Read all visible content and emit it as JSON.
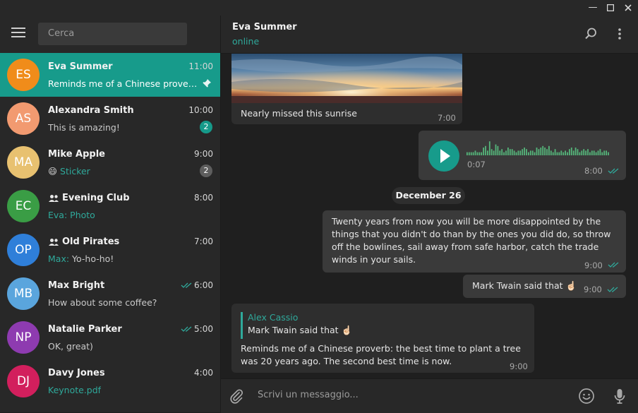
{
  "window": {
    "min_glyph": "—",
    "max_glyph": "☐",
    "close_glyph": "✕"
  },
  "sidebar": {
    "search_placeholder": "Cerca",
    "chats": [
      {
        "initials": "ES",
        "name": "Eva Summer",
        "time": "11:00",
        "preview": "Reminds me of a Chinese proverb: the best time to plant a tree…",
        "color": "#f08c1a",
        "pinned": true,
        "active": true
      },
      {
        "initials": "AS",
        "name": "Alexandra Smith",
        "time": "10:00",
        "preview": "This is amazing!",
        "color": "#f29a70",
        "badge": "2"
      },
      {
        "initials": "MA",
        "name": "Mike Apple",
        "time": "9:00",
        "preview_emoji": "😄",
        "preview": "Sticker",
        "color": "#e8c170",
        "badge": "2"
      },
      {
        "initials": "EC",
        "name": "Evening Club",
        "time": "8:00",
        "preview_sender": "Eva:",
        "preview": "Photo",
        "color": "#3a9d45",
        "group": true
      },
      {
        "initials": "OP",
        "name": "Old Pirates",
        "time": "7:00",
        "preview_sender": "Max:",
        "preview": "Yo-ho-ho!",
        "color": "#2f7fd9",
        "group": true
      },
      {
        "initials": "MB",
        "name": "Max Bright",
        "time": "6:00",
        "preview": "How about some coffee?",
        "color": "#5aa5dd",
        "read": true
      },
      {
        "initials": "NP",
        "name": "Natalie Parker",
        "time": "5:00",
        "preview": "OK, great)",
        "color": "#8e3bb0",
        "read": true
      },
      {
        "initials": "DJ",
        "name": "Davy Jones",
        "time": "4:00",
        "preview": "Keynote.pdf",
        "color": "#d21f5d"
      }
    ]
  },
  "header": {
    "title": "Eva Summer",
    "status": "online"
  },
  "messages": {
    "photo_caption": "Nearly missed this sunrise",
    "photo_time": "7:00",
    "voice_duration": "0:07",
    "voice_time": "8:00",
    "voice_levels": [
      2,
      2,
      2,
      2,
      3,
      2,
      2,
      2,
      5,
      6,
      3,
      9,
      4,
      3,
      7,
      6,
      3,
      4,
      2,
      3,
      5,
      4,
      4,
      3,
      2,
      3,
      3,
      4,
      5,
      4,
      2,
      3,
      3,
      2,
      5,
      4,
      5,
      6,
      5,
      4,
      6,
      3,
      2,
      4,
      2,
      2,
      3,
      2,
      3,
      2,
      4,
      5,
      3,
      5,
      4,
      2,
      3,
      4,
      3,
      4,
      2,
      3,
      3,
      2,
      3,
      4,
      2,
      3,
      3,
      2
    ],
    "date_divider": "December 26",
    "quote_text": "Twenty years from now you will be more disappointed by the things that you didn't do than by the ones you did do, so throw off the bowlines, sail away from safe harbor, catch the trade winds in your sails.",
    "quote_time": "9:00",
    "twain_text": "Mark Twain said that ☝🏻",
    "twain_time": "9:00",
    "reply_author": "Alex Cassio",
    "reply_quote": "Mark Twain said that ☝🏻",
    "reply_text": "Reminds me of a Chinese proverb: the best time to plant a tree was 20 years ago. The second best time is now.",
    "reply_time": "9:00"
  },
  "composer": {
    "placeholder": "Scrivi un messaggio..."
  },
  "colors": {
    "accent": "#179b8b",
    "accent_text": "#2fa99b",
    "play_button": "#179b8b",
    "wave": "#55b57a"
  }
}
